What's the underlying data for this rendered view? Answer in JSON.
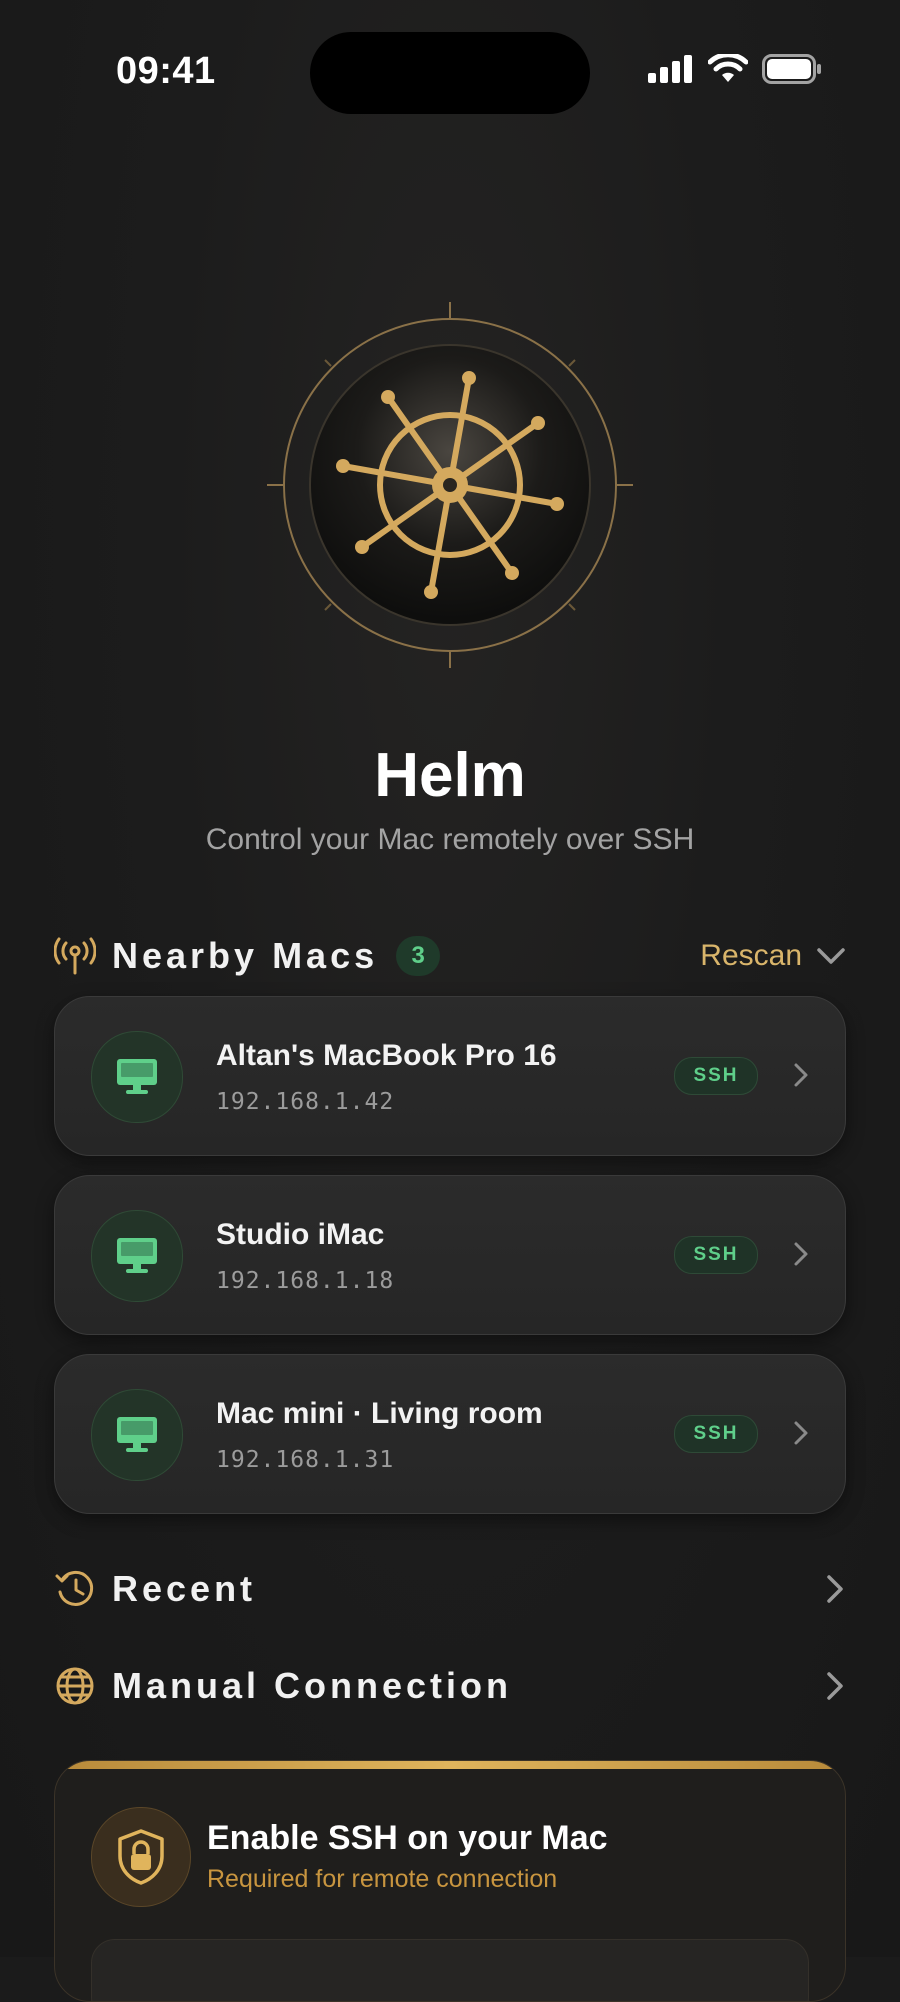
{
  "status_bar": {
    "time": "09:41"
  },
  "app": {
    "title": "Helm",
    "subtitle": "Control your Mac remotely over SSH"
  },
  "nearby": {
    "title": "Nearby Macs",
    "count": "3",
    "rescan_label": "Rescan",
    "devices": [
      {
        "name": "Altan's MacBook Pro 16",
        "ip": "192.168.1.42",
        "badge": "SSH"
      },
      {
        "name": "Studio iMac",
        "ip": "192.168.1.18",
        "badge": "SSH"
      },
      {
        "name": "Mac mini · Living room",
        "ip": "192.168.1.31",
        "badge": "SSH"
      }
    ]
  },
  "recent": {
    "title": "Recent"
  },
  "manual": {
    "title": "Manual Connection"
  },
  "enable_ssh": {
    "title": "Enable SSH on your Mac",
    "subtitle": "Required for remote connection"
  },
  "colors": {
    "accent_gold": "#d9b56b",
    "accent_green": "#5fcf8a",
    "background": "#1b1b1b"
  },
  "icons": [
    "signal-icon",
    "wifi-icon",
    "battery-icon",
    "helm-wheel-icon",
    "antenna-icon",
    "chevron-down-icon",
    "monitor-icon",
    "chevron-right-icon",
    "history-icon",
    "globe-icon",
    "lock-shield-icon"
  ]
}
